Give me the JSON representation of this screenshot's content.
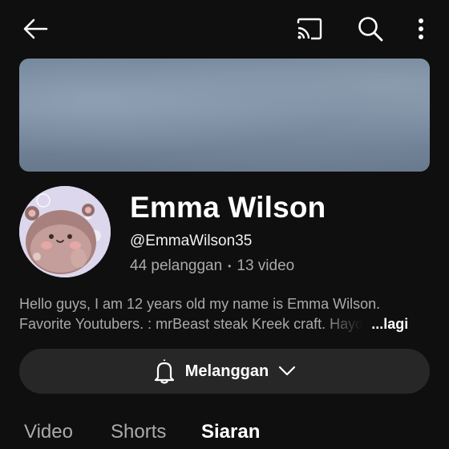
{
  "topbar": {
    "back_icon": "arrow-left-icon",
    "cast_icon": "cast-icon",
    "search_icon": "search-icon",
    "more_icon": "more-vertical-icon"
  },
  "channel": {
    "name": "Emma Wilson",
    "handle": "@EmmaWilson35",
    "subscribers": "44 pelanggan",
    "separator": "•",
    "videos": "13 video",
    "description_line1": "Hello guys, I am 12 years old my name is Emma Wilson.",
    "description_line2": "Favorite Youtubers. : mrBeast steak Kreek craft. Hayd",
    "more_label": "...lagi"
  },
  "subscribe_button": {
    "label": "Melanggan",
    "icon": "bell-icon",
    "chevron": "chevron-down-icon"
  },
  "tabs": [
    {
      "label": "Video"
    },
    {
      "label": "Shorts"
    },
    {
      "label": "Siaran"
    }
  ],
  "colors": {
    "background": "#0f0f0f",
    "button_bg": "#272727",
    "secondary_text": "#aaaaaa"
  }
}
